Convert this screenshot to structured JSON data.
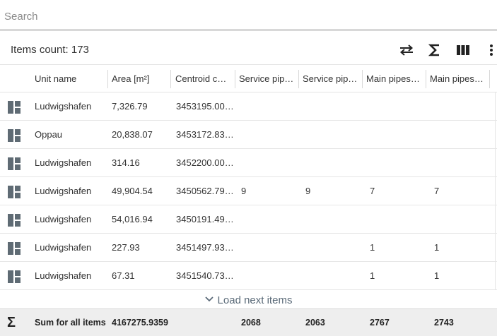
{
  "search": {
    "placeholder": "Search",
    "value": ""
  },
  "toolbar": {
    "items_count": "Items count: 173",
    "icons": [
      "swap-horizontal-icon",
      "sigma-icon",
      "columns-icon",
      "more-vertical-icon"
    ]
  },
  "columns": [
    "Unit name",
    "Area [m²]",
    "Centroid c…",
    "Service pip…",
    "Service pip…",
    "Main pipes…",
    "Main pipes…"
  ],
  "rows": [
    {
      "unit": "Ludwigshafen",
      "area": "7,326.79",
      "centroid": "3453195.00,…",
      "sp1": "",
      "sp2": "",
      "mp1": "",
      "mp2": ""
    },
    {
      "unit": "Oppau",
      "area": "20,838.07",
      "centroid": "3453172.83,…",
      "sp1": "",
      "sp2": "",
      "mp1": "",
      "mp2": ""
    },
    {
      "unit": "Ludwigshafen",
      "area": "314.16",
      "centroid": "3452200.00,…",
      "sp1": "",
      "sp2": "",
      "mp1": "",
      "mp2": ""
    },
    {
      "unit": "Ludwigshafen",
      "area": "49,904.54",
      "centroid": "3450562.79,…",
      "sp1": "9",
      "sp2": "9",
      "mp1": "7",
      "mp2": "7"
    },
    {
      "unit": "Ludwigshafen",
      "area": "54,016.94",
      "centroid": "3450191.49,…",
      "sp1": "",
      "sp2": "",
      "mp1": "",
      "mp2": ""
    },
    {
      "unit": "Ludwigshafen",
      "area": "227.93",
      "centroid": "3451497.93,…",
      "sp1": "",
      "sp2": "",
      "mp1": "1",
      "mp2": "1"
    },
    {
      "unit": "Ludwigshafen",
      "area": "67.31",
      "centroid": "3451540.73,…",
      "sp1": "",
      "sp2": "",
      "mp1": "1",
      "mp2": "1"
    }
  ],
  "load_next": {
    "label": "Load next items",
    "icon": "chevron-down-icon"
  },
  "footer": {
    "icon": "sigma-icon",
    "label": "Sum for all items",
    "area": "4167275.9359",
    "sp1": "2068",
    "sp2": "2063",
    "mp1": "2767",
    "mp2": "2743"
  }
}
